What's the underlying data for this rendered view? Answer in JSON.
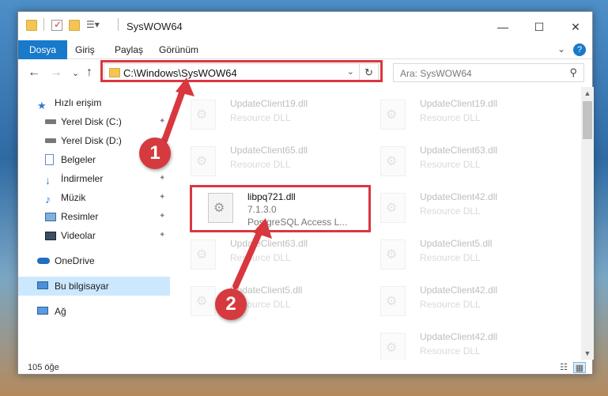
{
  "window": {
    "title": "SysWOW64",
    "controls": {
      "minimize": "—",
      "maximize": "☐",
      "close": "✕"
    }
  },
  "ribbon": {
    "tabs": [
      "Dosya",
      "Giriş",
      "Paylaş",
      "Görünüm"
    ],
    "expand_icon": "⌄",
    "help_icon": "?"
  },
  "nav": {
    "back": "←",
    "forward": "→",
    "recent": "⌄",
    "up": "↑",
    "address": "C:\\Windows\\SysWOW64",
    "search_placeholder": "Ara: SysWOW64",
    "refresh": "↻",
    "dropdown": "⌄",
    "search_icon": "⚲"
  },
  "sidebar": {
    "items": [
      {
        "label": "Hızlı erişim",
        "icon": "star-icon",
        "pinned": false
      },
      {
        "label": "Yerel Disk (C:)",
        "icon": "drive-icon",
        "pinned": true
      },
      {
        "label": "Yerel Disk (D:)",
        "icon": "drive-icon",
        "pinned": true
      },
      {
        "label": "Belgeler",
        "icon": "documents-icon",
        "pinned": true
      },
      {
        "label": "İndirmeler",
        "icon": "download-icon",
        "pinned": true
      },
      {
        "label": "Müzik",
        "icon": "music-icon",
        "pinned": true
      },
      {
        "label": "Resimler",
        "icon": "pictures-icon",
        "pinned": true
      },
      {
        "label": "Videolar",
        "icon": "videos-icon",
        "pinned": true
      },
      {
        "label": "OneDrive",
        "icon": "cloud-icon",
        "pinned": false
      },
      {
        "label": "Bu bilgisayar",
        "icon": "computer-icon",
        "pinned": false
      },
      {
        "label": "Ağ",
        "icon": "network-icon",
        "pinned": false
      }
    ],
    "pin_glyph": "📌"
  },
  "files": [
    {
      "name": "UpdateClient19.dll",
      "line2": "Resource DLL"
    },
    {
      "name": "UpdateClient19.dll",
      "line2": "Resource DLL"
    },
    {
      "name": "UpdateClient65.dll",
      "line2": "Resource DLL"
    },
    {
      "name": "UpdateClient63.dll",
      "line2": "Resource DLL"
    },
    {
      "name": "libpq721.dll",
      "line2": "7.1.3.0",
      "line3": "PostgreSQL Access L..."
    },
    {
      "name": "UpdateClient42.dll",
      "line2": "Resource DLL"
    },
    {
      "name": "UpdateClient63.dll",
      "line2": "Resource DLL"
    },
    {
      "name": "UpdateClient5.dll",
      "line2": "Resource DLL"
    },
    {
      "name": "UpdateClient5.dll",
      "line2": "Resource DLL"
    },
    {
      "name": "UpdateClient42.dll",
      "line2": "Resource DLL"
    },
    {
      "name": "UpdateClient42.dll",
      "line2": "Resource DLL"
    }
  ],
  "status": {
    "count": "105 öğe"
  },
  "annotations": {
    "badge1": "1",
    "badge2": "2"
  },
  "colors": {
    "accent": "#1979ca",
    "highlight": "#d9373f",
    "selected": "#cce8ff"
  }
}
